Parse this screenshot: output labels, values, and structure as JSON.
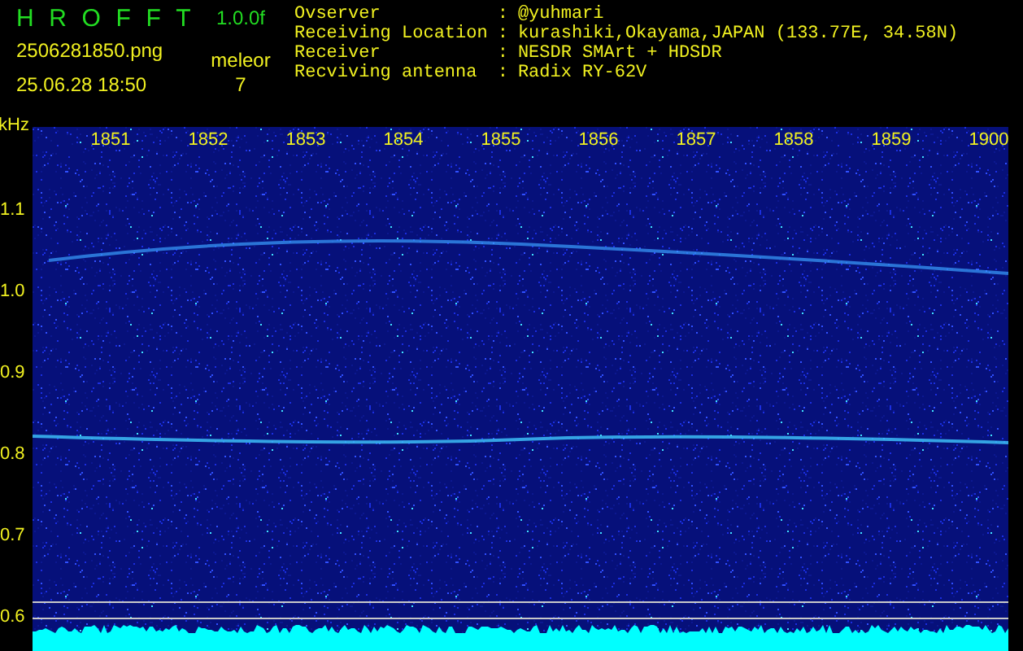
{
  "header": {
    "app_title": "HROFFT",
    "version": "1.0.0f",
    "filename": "2506281850.png",
    "timestamp": "25.06.28 18:50",
    "count_label": "meleor",
    "count": "7",
    "separator": ":",
    "info": [
      {
        "label": "Ovserver",
        "value": "@yuhmari"
      },
      {
        "label": "Receiving Location",
        "value": "kurashiki,Okayama,JAPAN (133.77E, 34.58N)"
      },
      {
        "label": "Receiver",
        "value": "NESDR SMArt + HDSDR"
      },
      {
        "label": "Recviving antenna",
        "value": "Radix RY-62V"
      }
    ]
  },
  "spectrogram": {
    "unit": "kHz",
    "frequency_labels": [
      "1.1",
      "1.0",
      "0.9",
      "0.8",
      "0.7",
      "0.6"
    ],
    "time_labels": [
      "1851",
      "1852",
      "1853",
      "1854",
      "1855",
      "1856",
      "1857",
      "1858",
      "1859",
      "1900"
    ]
  }
}
